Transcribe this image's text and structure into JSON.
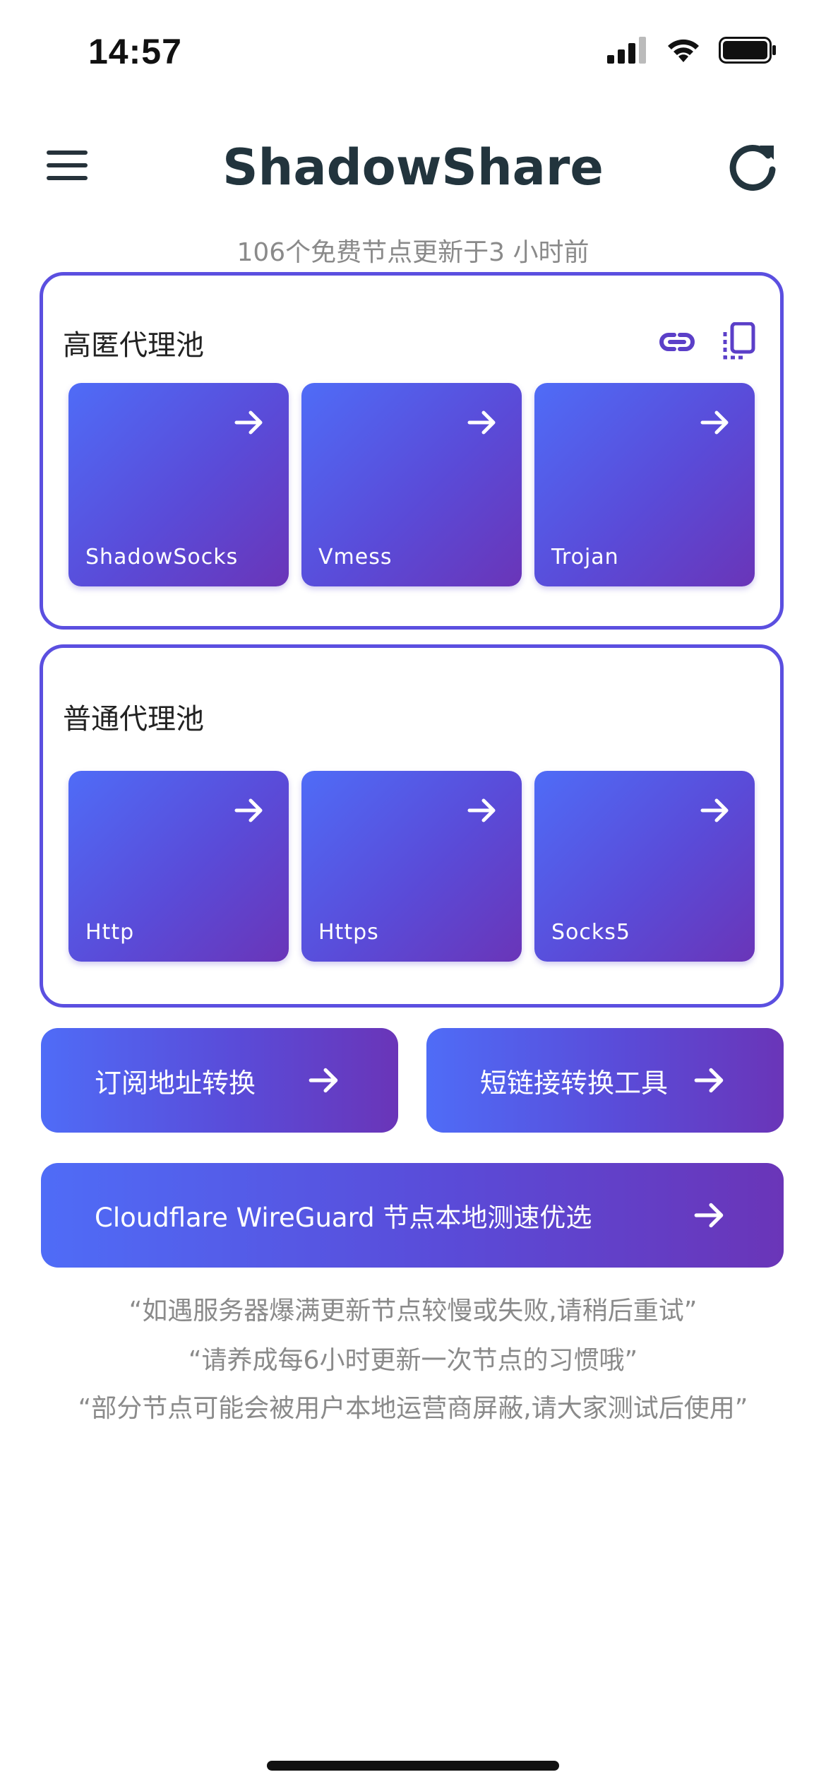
{
  "status_bar": {
    "time": "14:57"
  },
  "header": {
    "title": "ShadowShare"
  },
  "subtitle": "106个免费节点更新于3 小时前",
  "premium_pool": {
    "title": "高匿代理池",
    "tiles": [
      {
        "label": "ShadowSocks"
      },
      {
        "label": "Vmess"
      },
      {
        "label": "Trojan"
      }
    ]
  },
  "normal_pool": {
    "title": "普通代理池",
    "tiles": [
      {
        "label": "Http"
      },
      {
        "label": "Https"
      },
      {
        "label": "Socks5"
      }
    ]
  },
  "tools": {
    "subscribe_convert": "订阅地址转换",
    "short_link": "短链接转换工具",
    "wireguard": "Cloudflare WireGuard 节点本地测速优选"
  },
  "notes": [
    "“如遇服务器爆满更新节点较慢或失败,请稍后重试”",
    "“请养成每6小时更新一次节点的习惯哦”",
    "“部分节点可能会被用户本地运营商屏蔽,请大家测试后使用”"
  ],
  "colors": {
    "accent": "#5b4fe0",
    "gradient_start": "#4f6cf7",
    "gradient_end": "#6a35b8"
  }
}
